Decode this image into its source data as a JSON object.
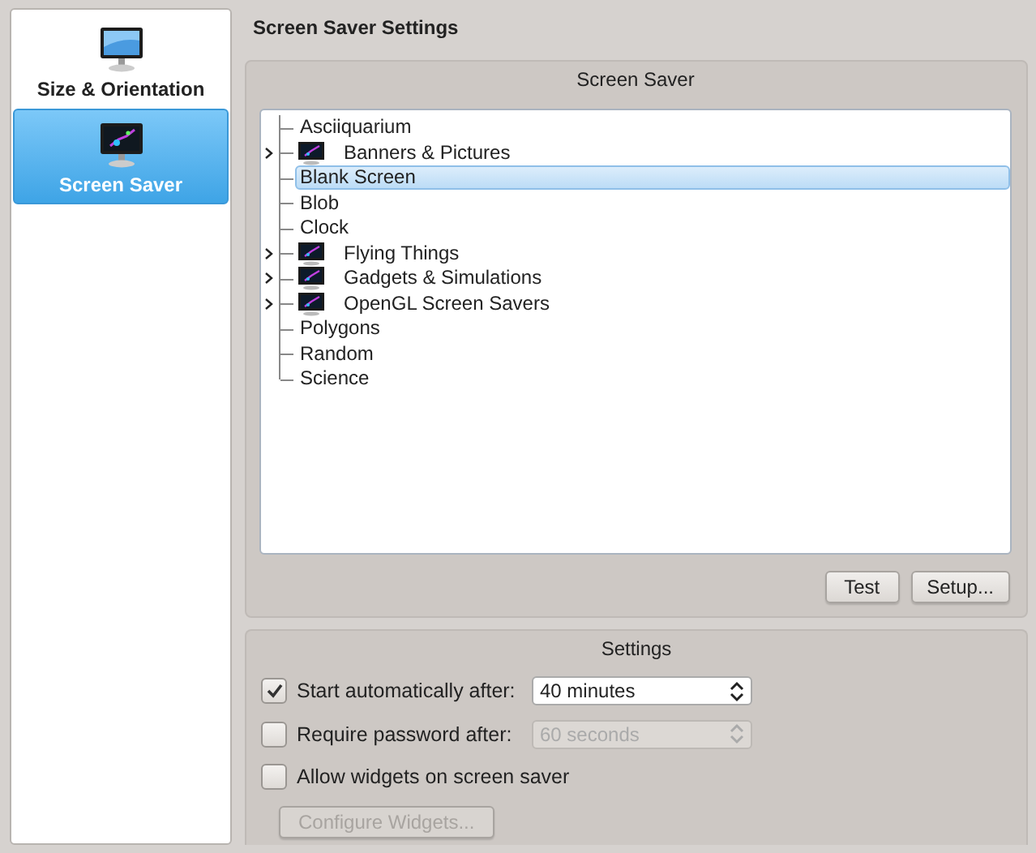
{
  "sidebar": {
    "items": [
      {
        "label": "Size & Orientation",
        "selected": false
      },
      {
        "label": "Screen Saver",
        "selected": true
      }
    ]
  },
  "page_title": "Screen Saver Settings",
  "screen_saver_group": {
    "title": "Screen Saver",
    "tree": [
      {
        "label": "Asciiquarium",
        "expandable": false,
        "selected": false
      },
      {
        "label": "Banners & Pictures",
        "expandable": true,
        "selected": false
      },
      {
        "label": "Blank Screen",
        "expandable": false,
        "selected": true
      },
      {
        "label": "Blob",
        "expandable": false,
        "selected": false
      },
      {
        "label": "Clock",
        "expandable": false,
        "selected": false
      },
      {
        "label": "Flying Things",
        "expandable": true,
        "selected": false
      },
      {
        "label": "Gadgets & Simulations",
        "expandable": true,
        "selected": false
      },
      {
        "label": "OpenGL Screen Savers",
        "expandable": true,
        "selected": false
      },
      {
        "label": "Polygons",
        "expandable": false,
        "selected": false
      },
      {
        "label": "Random",
        "expandable": false,
        "selected": false
      },
      {
        "label": "Science",
        "expandable": false,
        "selected": false
      }
    ],
    "buttons": [
      "Test",
      "Setup..."
    ]
  },
  "settings_group": {
    "title": "Settings",
    "rows": [
      {
        "kind": "checkbox-spin",
        "label": "Start automatically after:",
        "checked": true,
        "value": "40 minutes",
        "disabled": false
      },
      {
        "kind": "checkbox-spin",
        "label": "Require password after:",
        "checked": false,
        "value": "60 seconds",
        "disabled": true
      },
      {
        "kind": "checkbox",
        "label": "Allow widgets on screen saver",
        "checked": false
      },
      {
        "kind": "button",
        "label": "Configure Widgets...",
        "disabled": true
      }
    ]
  }
}
